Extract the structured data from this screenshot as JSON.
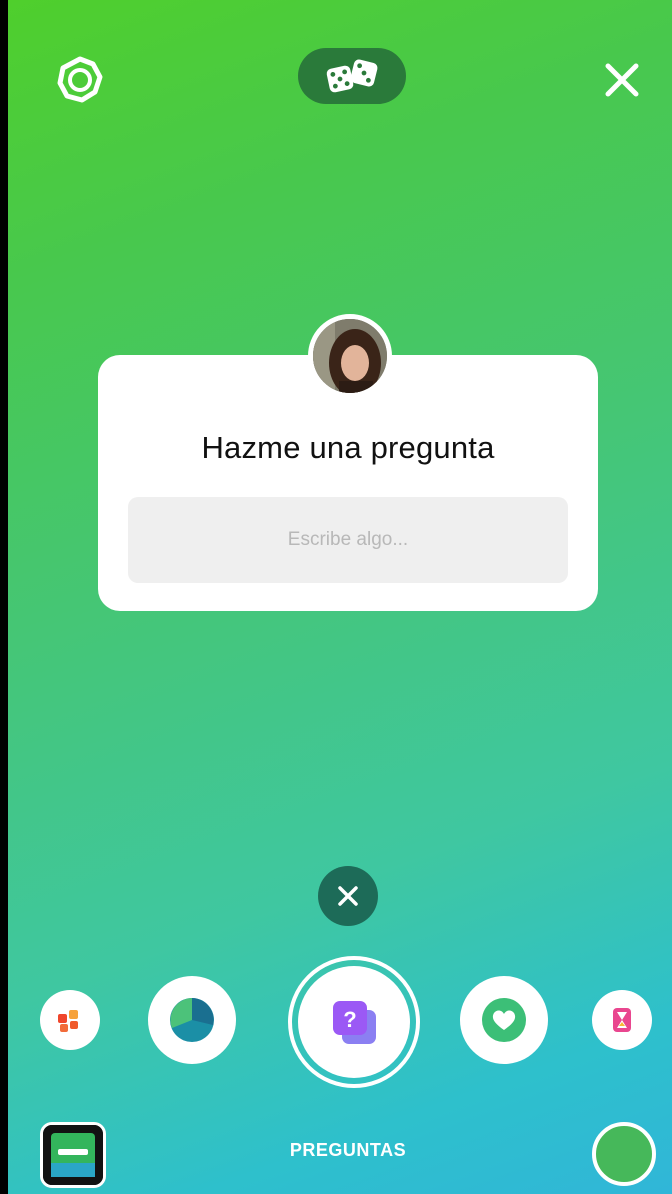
{
  "sticker": {
    "title": "Hazme una pregunta",
    "input_placeholder": "Escribe algo..."
  },
  "tray": {
    "active_label": "PREGUNTAS"
  },
  "colors": {
    "gradient_top": "#4fcf2c",
    "gradient_bottom": "#30b6d8",
    "dice_pill": "#2a7a3a",
    "dismiss_button": "#1d6b58",
    "questions_icon": "#9b59f5",
    "color_picker": "#46b85a"
  },
  "icons": {
    "settings": "settings-icon",
    "dice": "dice-icon",
    "close": "close-icon",
    "dismiss": "close-icon",
    "tray": [
      "sticker-grid-icon",
      "poll-icon",
      "questions-icon",
      "emoji-slider-icon",
      "countdown-icon"
    ]
  }
}
